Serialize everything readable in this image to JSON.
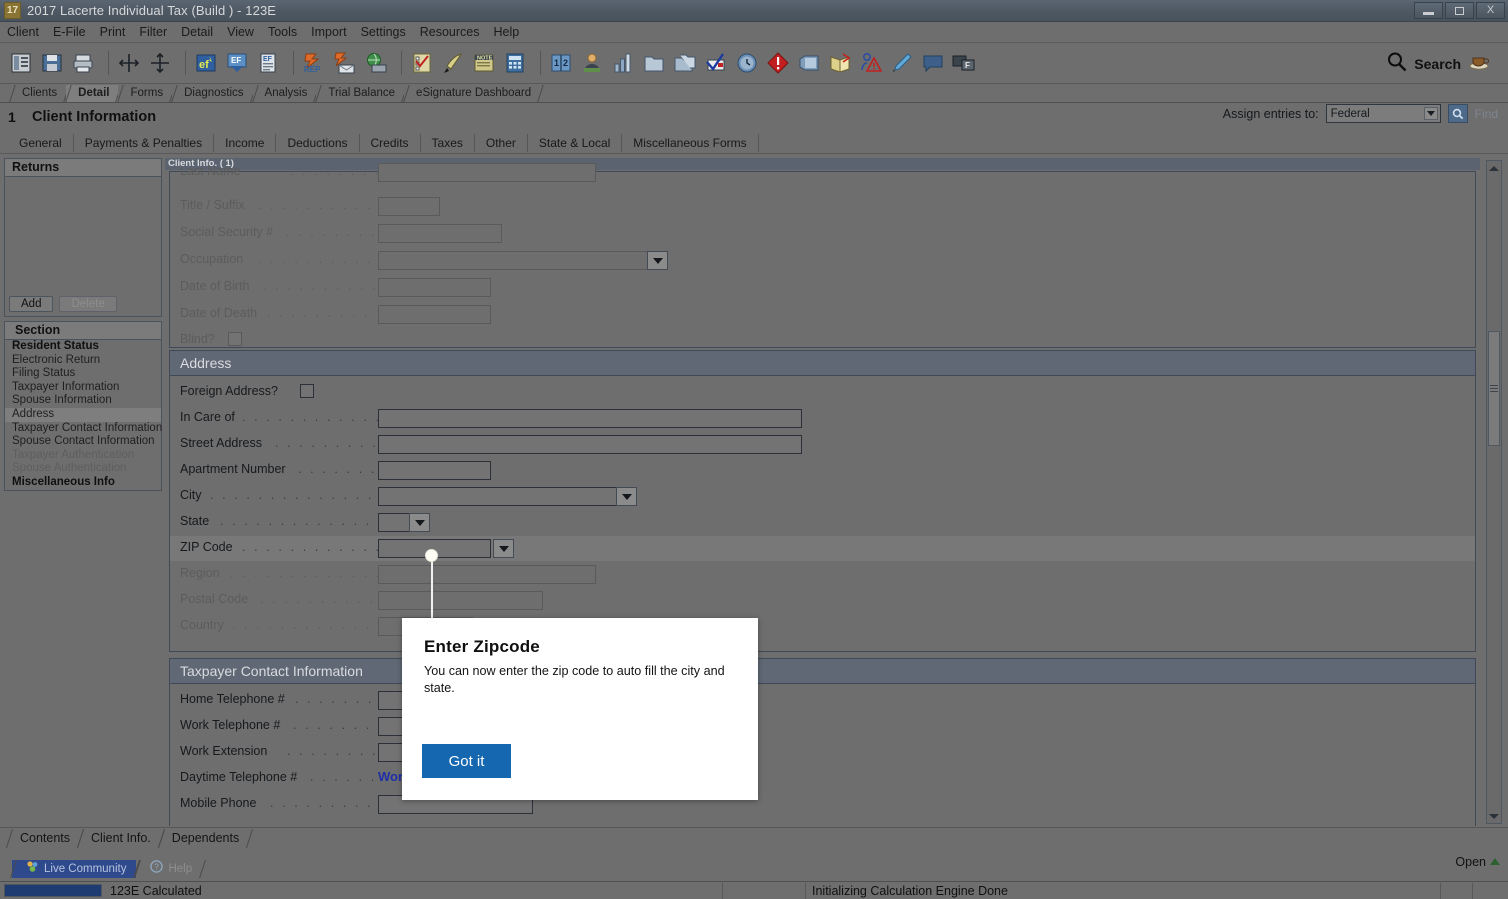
{
  "window": {
    "title": "2017 Lacerte Individual Tax (Build ) - 123E",
    "app_icon": "17",
    "controls": {
      "minimize": "minimize-icon",
      "restore": "restore-icon",
      "close": "X"
    }
  },
  "menu": {
    "items": [
      "Client",
      "E-File",
      "Print",
      "Filter",
      "Detail",
      "View",
      "Tools",
      "Import",
      "Settings",
      "Resources",
      "Help"
    ]
  },
  "toolbar": {
    "icons": [
      "ledger-icon",
      "save-icon",
      "print-icon",
      "expand-horizontal-icon",
      "expand-vertical-icon",
      "efile-icon",
      "efile-download-icon",
      "ef-document-icon",
      "rep-lightning-icon",
      "lightning-envelope-icon",
      "globe-laptop-icon",
      "checklist-icon",
      "pen-icon",
      "note-icon",
      "calculator-icon",
      "book-icon",
      "person-icon",
      "bar-chart-icon",
      "folder-icon",
      "copy-folder-icon",
      "check-mail-icon",
      "clock-icon",
      "alert-icon",
      "monitor-icon",
      "open-book-icon",
      "warning-person-icon",
      "pencil-icon",
      "comment-icon",
      "remote-icon"
    ],
    "search_label": "Search",
    "search_icon": "search-icon",
    "coffee_icon": "coffee-icon"
  },
  "module_tabs": [
    {
      "label": "Clients",
      "active": false
    },
    {
      "label": "Detail",
      "active": true
    },
    {
      "label": "Forms",
      "active": false
    },
    {
      "label": "Diagnostics",
      "active": false
    },
    {
      "label": "Analysis",
      "active": false
    },
    {
      "label": "Trial Balance",
      "active": false
    },
    {
      "label": "eSignature Dashboard",
      "active": false
    }
  ],
  "page_header": {
    "number": "1",
    "title": "Client Information",
    "assign_label": "Assign entries to:",
    "assign_value": "Federal",
    "find_label": "Find",
    "find_icon": "search-icon"
  },
  "section_tabs": [
    "General",
    "Payments & Penalties",
    "Income",
    "Deductions",
    "Credits",
    "Taxes",
    "Other",
    "State & Local",
    "Miscellaneous Forms"
  ],
  "left_panel": {
    "returns_header": "Returns",
    "add_label": "Add",
    "delete_label": "Delete",
    "section_header": "Section",
    "sections": [
      {
        "label": "Resident Status",
        "bold": true,
        "selected": false,
        "dim": false
      },
      {
        "label": "Electronic Return",
        "bold": false,
        "selected": false,
        "dim": false
      },
      {
        "label": "Filing Status",
        "bold": false,
        "selected": false,
        "dim": false
      },
      {
        "label": "Taxpayer Information",
        "bold": false,
        "selected": false,
        "dim": false
      },
      {
        "label": "Spouse Information",
        "bold": false,
        "selected": false,
        "dim": false
      },
      {
        "label": "Address",
        "bold": false,
        "selected": true,
        "dim": false
      },
      {
        "label": "Taxpayer Contact Information",
        "bold": false,
        "selected": false,
        "dim": false
      },
      {
        "label": "Spouse Contact Information",
        "bold": false,
        "selected": false,
        "dim": false
      },
      {
        "label": "Taxpayer Authentication",
        "bold": false,
        "selected": false,
        "dim": true
      },
      {
        "label": "Spouse Authentication",
        "bold": false,
        "selected": false,
        "dim": true
      },
      {
        "label": "Miscellaneous Info",
        "bold": true,
        "selected": false,
        "dim": false
      }
    ]
  },
  "form": {
    "client_info_tab": "Client Info.  ( 1)",
    "top_fields": [
      {
        "label": "Last Name",
        "value": "",
        "type": "text",
        "dim": true
      },
      {
        "label": "Title / Suffix",
        "value": "",
        "type": "text",
        "dim": true
      },
      {
        "label": "Social Security #",
        "value": "",
        "type": "text",
        "dim": true
      },
      {
        "label": "Occupation",
        "value": "",
        "type": "combo",
        "dim": true
      },
      {
        "label": "Date of Birth",
        "value": "",
        "type": "text",
        "dim": true
      },
      {
        "label": "Date of Death",
        "value": "",
        "type": "text",
        "dim": true
      },
      {
        "label": "Blind?",
        "value": "",
        "type": "checkbox",
        "dim": true
      }
    ],
    "address_group": {
      "title": "Address",
      "fields": [
        {
          "label": "Foreign Address?",
          "value": "",
          "type": "checkbox",
          "dim": false
        },
        {
          "label": "In Care of",
          "value": "",
          "type": "text",
          "dim": false
        },
        {
          "label": "Street Address",
          "value": "",
          "type": "text",
          "dim": false
        },
        {
          "label": "Apartment Number",
          "value": "",
          "type": "text",
          "dim": false
        },
        {
          "label": "City",
          "value": "",
          "type": "combo",
          "dim": false
        },
        {
          "label": "State",
          "value": "",
          "type": "combo",
          "dim": false
        },
        {
          "label": "ZIP Code",
          "value": "",
          "type": "combo",
          "dim": false,
          "highlighted": true
        },
        {
          "label": "Region",
          "value": "",
          "type": "text",
          "dim": true
        },
        {
          "label": "Postal Code",
          "value": "",
          "type": "text",
          "dim": true
        },
        {
          "label": "Country",
          "value": "",
          "type": "text",
          "dim": true
        }
      ]
    },
    "contact_group": {
      "title": "Taxpayer Contact Information",
      "fields": [
        {
          "label": "Home Telephone #",
          "value": "",
          "type": "text",
          "dim": false
        },
        {
          "label": "Work Telephone #",
          "value": "",
          "type": "text",
          "dim": false
        },
        {
          "label": "Work Extension",
          "value": "",
          "type": "text",
          "dim": false
        },
        {
          "label": "Daytime Telephone #",
          "value": "Wor",
          "type": "bluetext",
          "dim": false
        },
        {
          "label": "Mobile Phone",
          "value": "",
          "type": "text",
          "dim": false
        }
      ]
    }
  },
  "tooltip": {
    "title": "Enter Zipcode",
    "body": "You can now enter the zip code to auto fill the city and state.",
    "button_label": "Got it",
    "button_color": "#1567b0"
  },
  "bottom_tabs": [
    "Contents",
    "Client Info.",
    "Dependents"
  ],
  "open_panel": {
    "label": "Open",
    "arrow_icon": "chevron-up-icon"
  },
  "community_bar": {
    "live_community": "Live Community",
    "live_community_icon": "community-icon",
    "help": "Help",
    "help_icon": "question-icon"
  },
  "status_bar": {
    "progress_label": "123E Calculated",
    "engine_message": "Initializing Calculation Engine Done"
  }
}
